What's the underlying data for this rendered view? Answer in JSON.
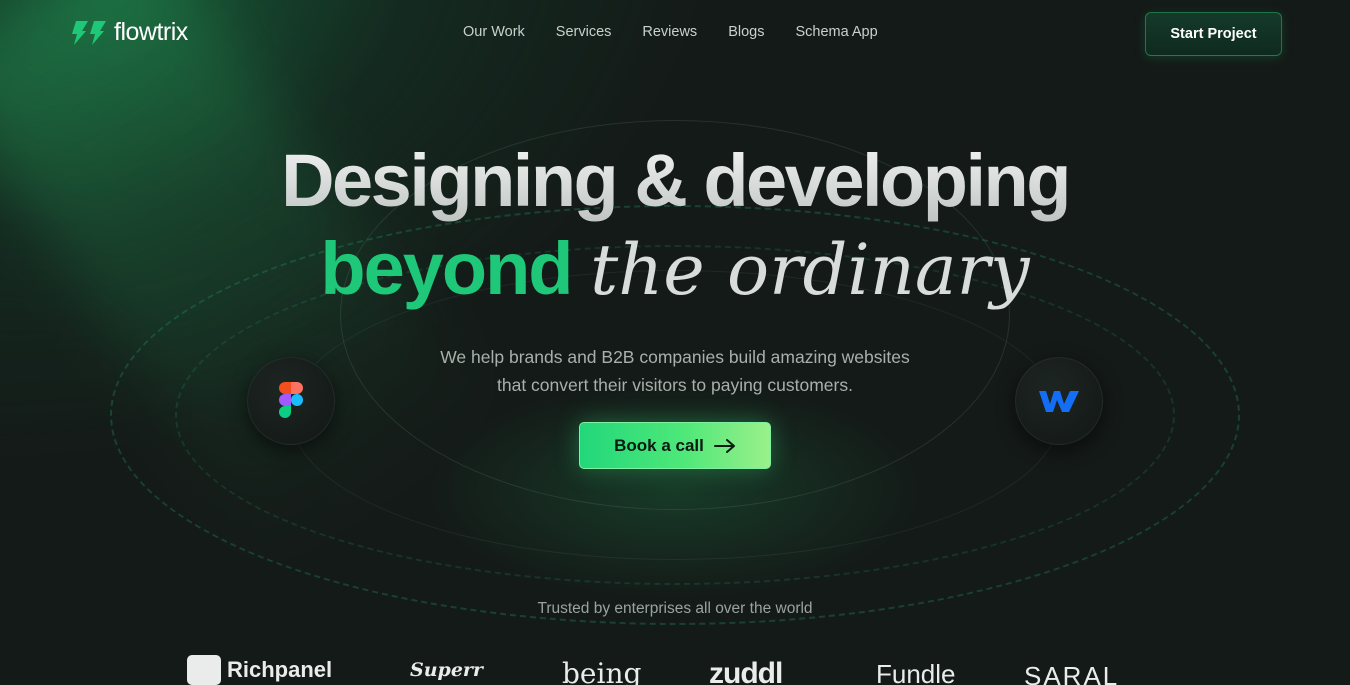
{
  "brand": {
    "name": "flowtrix"
  },
  "nav": {
    "items": [
      "Our Work",
      "Services",
      "Reviews",
      "Blogs",
      "Schema App"
    ]
  },
  "header": {
    "cta_label": "Start Project"
  },
  "hero": {
    "line1": "Designing & developing",
    "line2_green": "beyond",
    "line2_serif": "the ordinary",
    "subtitle_line1": "We help brands and B2B companies build amazing websites",
    "subtitle_line2": "that convert their visitors to paying customers.",
    "cta_label": "Book a call",
    "tools": [
      "figma-icon",
      "webflow-icon"
    ]
  },
  "trusted": {
    "heading": "Trusted by enterprises all over the world",
    "logos": [
      "Richpanel",
      "Superr",
      "being",
      "zuddl",
      "Fundle",
      "SARAL"
    ]
  },
  "colors": {
    "background": "#141a18",
    "accent_green": "#1ec878",
    "cta_gradient_start": "#22d77a",
    "cta_gradient_end": "#9bf08a",
    "webflow_blue": "#146ef5"
  }
}
